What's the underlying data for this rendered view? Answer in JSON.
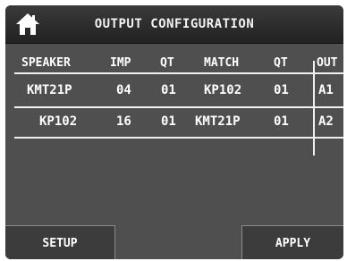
{
  "app": {
    "title": "OUTPUT CONFIGURATION",
    "home_icon": "home-icon"
  },
  "table": {
    "headers": [
      "SPEAKER",
      "IMP",
      "QT",
      "MATCH",
      "QT",
      "OUT"
    ],
    "rows": [
      [
        "KMT21P",
        "04",
        "01",
        "KP102",
        "01",
        "A1"
      ],
      [
        "KP102",
        "16",
        "01",
        "KMT21P",
        "01",
        "A2"
      ]
    ]
  },
  "footer": {
    "setup_label": "SETUP",
    "apply_label": "APPLY"
  },
  "colors": {
    "background": "#4f4f4f",
    "titlebar": "#2a2a2a",
    "text": "#ffffff"
  }
}
